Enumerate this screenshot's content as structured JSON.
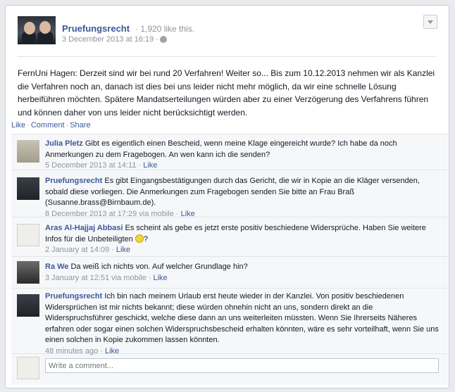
{
  "post": {
    "page_name": "Pruefungsrecht",
    "likes": "· 1,920 like this.",
    "date": "3 December 2013 at 16:19 ·",
    "text": "FernUni Hagen: Derzeit sind wir bei rund 20 Verfahren! Weiter so... Bis zum 10.12.2013 nehmen wir als Kanzlei die Verfahren noch an, danach ist dies bei uns leider nicht mehr möglich, da wir eine schnelle Lösung herbeiführen möchten. Spätere Mandatserteilungen würden aber zu einer Verzögerung des Verfahrens führen und können daher von uns leider nicht berücksichtigt werden."
  },
  "actions": {
    "like": "Like",
    "comment": "Comment",
    "share": "Share"
  },
  "comments": [
    {
      "name": "Julia Pletz",
      "text": "Gibt es eigentlich einen Bescheid, wenn meine Klage eingereicht wurde? Ich habe da noch Anmerkungen zu dem Fragebogen. An wen kann ich die senden?",
      "meta": "5 December 2013 at 14:11 ·",
      "like": "Like"
    },
    {
      "name": "Pruefungsrecht",
      "text": "Es gibt Eingangsbestätigungen durch das Gericht, die wir in Kopie an die Kläger versenden, sobald diese vorliegen. Die Anmerkungen zum Fragebogen senden Sie bitte an Frau Braß (Susanne.brass@Birnbaum.de).",
      "meta": "8 December 2013 at 17:29 via mobile ·",
      "like": "Like"
    },
    {
      "name": "Aras Al-Hajjaj Abbasi",
      "text": "Es scheint als gebe es jetzt erste positiv beschiedene Widersprüche. Haben Sie weitere Infos für die Unbeteiligten",
      "text_after": "?",
      "meta": "2 January at 14:09 ·",
      "like": "Like"
    },
    {
      "name": "Ra We",
      "text": "Da weiß ich nichts von. Auf welcher Grundlage hin?",
      "meta": "3 January at 12:51 via mobile ·",
      "like": "Like"
    },
    {
      "name": "Pruefungsrecht",
      "text": "Ich bin nach meinem Urlaub erst heute wieder in der Kanzlei. Von positiv beschiedenen Widersprüchen ist mir nichts bekannt; diese würden ohnehin nicht an uns, sondern direkt an die Widerspruchsführer geschickt, welche diese dann an uns weiterleiten müssten. Wenn Sie Ihrerseits Näheres erfahren oder sogar einen solchen Widerspruchsbescheid erhalten könnten, wäre es sehr vorteilhaft, wenn Sie uns einen solchen in Kopie zukommen lassen könnten.",
      "meta": "48 minutes ago ·",
      "like": "Like"
    }
  ],
  "write_comment": {
    "placeholder": "Write a comment..."
  }
}
